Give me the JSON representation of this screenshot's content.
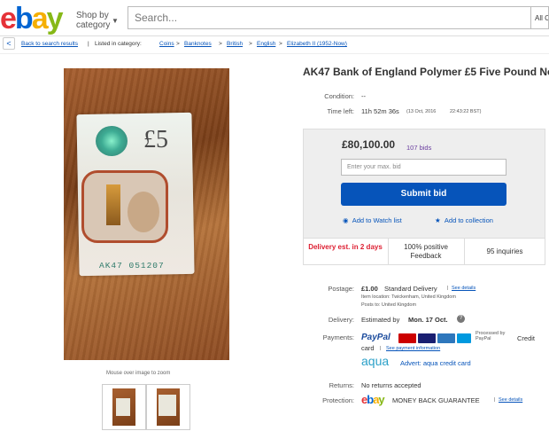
{
  "header": {
    "logo": {
      "e": "e",
      "b": "b",
      "a": "a",
      "y": "y"
    },
    "shop_by": "Shop by",
    "category": "category",
    "search_placeholder": "Search...",
    "category_select": "All C"
  },
  "breadcrumb": {
    "back": "Back to search results",
    "listed_in": "Listed in category:",
    "items": [
      "Coins",
      "Banknotes",
      "British",
      "English",
      "Elizabeth II (1952-Now)"
    ],
    "separator": ">"
  },
  "image": {
    "serial": "AK47 051207",
    "denomination": "£5",
    "zoom_hint": "Mouse over image to zoom"
  },
  "listing": {
    "title": "AK47 Bank of England Polymer £5 Five Pound No",
    "condition_label": "Condition:",
    "condition_value": "--",
    "time_left_label": "Time left:",
    "time_left_value": "11h 52m 36s",
    "time_left_date": "(13 Oct, 2016",
    "time_left_time": "22:43:22 BST)"
  },
  "bid_box": {
    "price": "£80,100.00",
    "bids": "107 bids",
    "input_placeholder": "Enter your max. bid",
    "submit": "Submit bid",
    "watch": "Add to Watch list",
    "collection": "Add to collection"
  },
  "stats": {
    "delivery": "Delivery est. in 2 days",
    "feedback": "100% positive Feedback",
    "inquiries": "95 inquiries"
  },
  "postage": {
    "label": "Postage:",
    "price": "£1.00",
    "service": "Standard Delivery",
    "see_details": "See details",
    "item_location": "Item location:  Twickenham, United Kingdom",
    "posts_to": "Posts to:  United Kingdom"
  },
  "delivery": {
    "label": "Delivery:",
    "estimated": "Estimated by",
    "date": "Mon. 17 Oct."
  },
  "payments": {
    "label": "Payments:",
    "paypal": "PayPal",
    "processed": "Processed by PayPal",
    "credit_card": "Credit card",
    "see_info": "See payment information",
    "aqua": "aqua",
    "aqua_advert": "Advert: aqua credit card",
    "cards": [
      {
        "name": "mastercard-icon",
        "color": "#cc0000"
      },
      {
        "name": "visa-icon",
        "color": "#1a1f71"
      },
      {
        "name": "amex-icon",
        "color": "#2e77bc"
      },
      {
        "name": "maestro-icon",
        "color": "#0099df"
      }
    ]
  },
  "returns": {
    "label": "Returns:",
    "value": "No returns accepted"
  },
  "protection": {
    "label": "Protection:",
    "logo": "ebay",
    "guarantee": "MONEY BACK GUARANTEE",
    "see_details": "See details"
  }
}
